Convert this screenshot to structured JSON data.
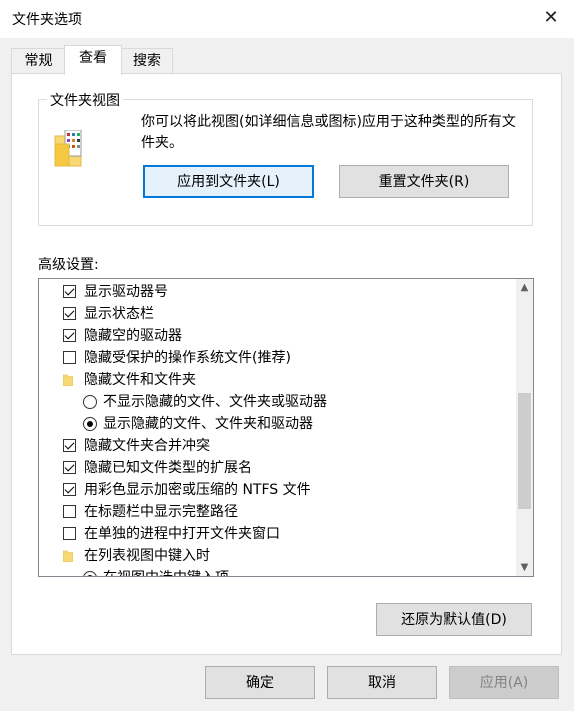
{
  "window": {
    "title": "文件夹选项",
    "close_glyph": "✕"
  },
  "tabs": [
    {
      "label": "常规"
    },
    {
      "label": "查看"
    },
    {
      "label": "搜索"
    }
  ],
  "folder_views": {
    "group_label": "文件夹视图",
    "description": "你可以将此视图(如详细信息或图标)应用于这种类型的所有文件夹。",
    "apply_button": "应用到文件夹(L)",
    "reset_button": "重置文件夹(R)"
  },
  "advanced": {
    "label": "高级设置:",
    "items": [
      {
        "text": "显示驱动器号",
        "kind": "checkbox",
        "checked": true
      },
      {
        "text": "显示状态栏",
        "kind": "checkbox",
        "checked": true
      },
      {
        "text": "隐藏空的驱动器",
        "kind": "checkbox",
        "checked": true
      },
      {
        "text": "隐藏受保护的操作系统文件(推荐)",
        "kind": "checkbox",
        "checked": false
      },
      {
        "text": "隐藏文件和文件夹",
        "kind": "folder"
      },
      {
        "text": "不显示隐藏的文件、文件夹或驱动器",
        "kind": "radio",
        "checked": false
      },
      {
        "text": "显示隐藏的文件、文件夹和驱动器",
        "kind": "radio",
        "checked": true
      },
      {
        "text": "隐藏文件夹合并冲突",
        "kind": "checkbox",
        "checked": true
      },
      {
        "text": "隐藏已知文件类型的扩展名",
        "kind": "checkbox",
        "checked": true
      },
      {
        "text": "用彩色显示加密或压缩的 NTFS 文件",
        "kind": "checkbox",
        "checked": true
      },
      {
        "text": "在标题栏中显示完整路径",
        "kind": "checkbox",
        "checked": false
      },
      {
        "text": "在单独的进程中打开文件夹窗口",
        "kind": "checkbox",
        "checked": false
      },
      {
        "text": "在列表视图中键入时",
        "kind": "folder"
      },
      {
        "text": "在视图中选中键入项",
        "kind": "radio",
        "checked": true
      }
    ],
    "restore_button": "还原为默认值(D)"
  },
  "footer": {
    "ok": "确定",
    "cancel": "取消",
    "apply": "应用(A)"
  },
  "colors": {
    "accent": "#0078d7",
    "folder": "#f8d775"
  }
}
